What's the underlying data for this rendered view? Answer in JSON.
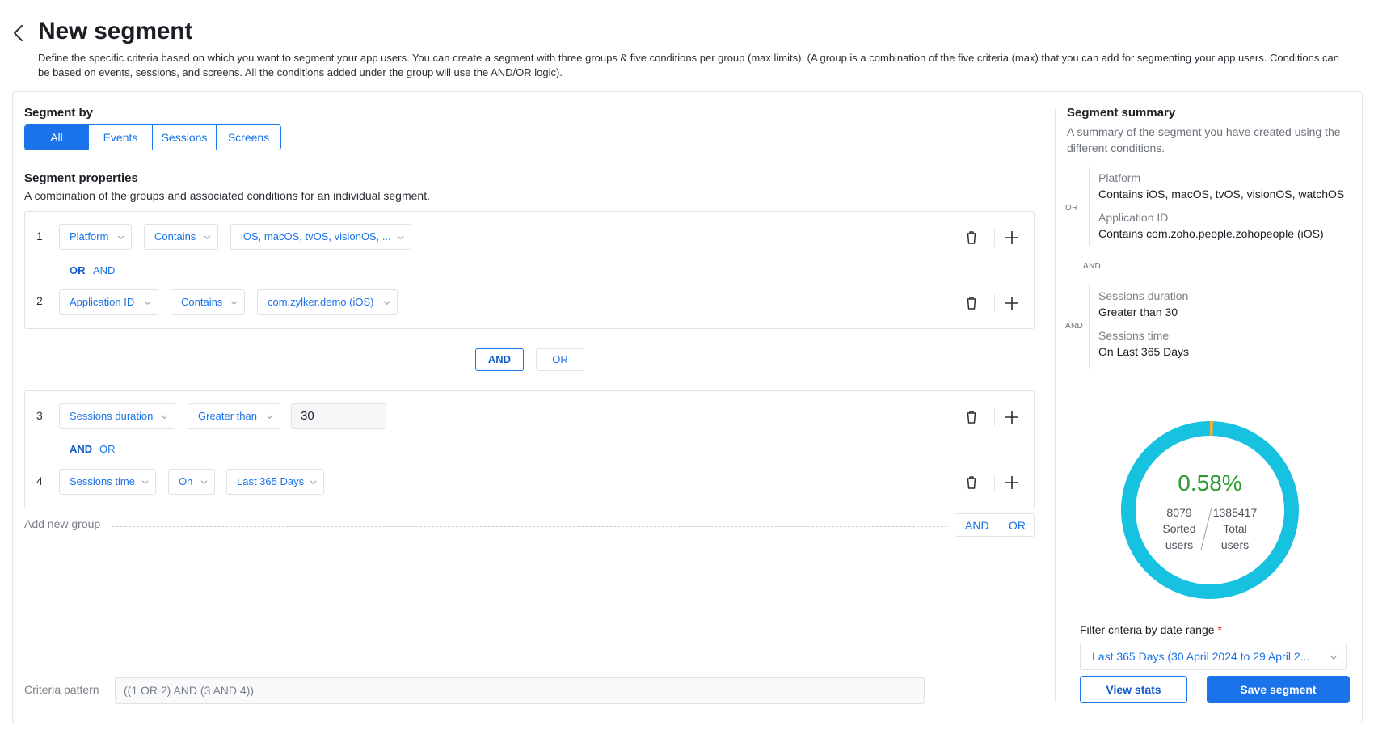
{
  "header": {
    "title": "New segment",
    "description": "Define the specific criteria based on which you want to segment your app users. You can create a segment with three groups & five conditions per group (max limits). (A group is a combination of the five criteria (max) that you can add for segmenting your app users. Conditions can be based on events, sessions, and screens. All the conditions added under the group will use the AND/OR logic)."
  },
  "segment_by": {
    "label": "Segment by",
    "tabs": [
      {
        "label": "All",
        "active": true
      },
      {
        "label": "Events",
        "active": false
      },
      {
        "label": "Sessions",
        "active": false
      },
      {
        "label": "Screens",
        "active": false
      }
    ]
  },
  "properties": {
    "label": "Segment properties",
    "subtitle": "A combination of the groups and associated conditions for an individual segment."
  },
  "groups": [
    {
      "conditions": [
        {
          "num": "1",
          "property": "Platform",
          "operator": "Contains",
          "value": "iOS, macOS, tvOS, visionOS, ..."
        },
        {
          "num": "2",
          "property": "Application ID",
          "operator": "Contains",
          "value": "com.zylker.demo (iOS)"
        }
      ],
      "logic_selected": "OR",
      "logic_other": "AND"
    },
    {
      "conditions": [
        {
          "num": "3",
          "property": "Sessions duration",
          "operator": "Greater than",
          "value": "30"
        },
        {
          "num": "4",
          "property": "Sessions time",
          "operator": "On",
          "value": "Last 365 Days"
        }
      ],
      "logic_selected": "AND",
      "logic_other": "OR"
    }
  ],
  "group_connector": {
    "selected": "AND",
    "other": "OR"
  },
  "add_group": {
    "label": "Add new group",
    "and_label": "AND",
    "or_label": "OR"
  },
  "criteria": {
    "label": "Criteria pattern",
    "value": "((1 OR 2) AND (3 AND 4))"
  },
  "summary": {
    "title": "Segment summary",
    "subtitle": "A summary of the segment you have created using the different conditions.",
    "group1_logic": "OR",
    "between_groups": "AND",
    "group2_logic": "AND",
    "items": [
      {
        "head": "Platform",
        "value": "Contains iOS, macOS, tvOS, visionOS, watchOS"
      },
      {
        "head": "Application ID",
        "value": "Contains com.zoho.people.zohopeople (iOS)"
      },
      {
        "head": "Sessions duration",
        "value": "Greater than 30"
      },
      {
        "head": "Sessions time",
        "value": "On Last 365 Days"
      }
    ]
  },
  "stats": {
    "percent": "0.58%",
    "percent_fraction": 0.0058,
    "sorted_count": "8079",
    "sorted_label_1": "Sorted",
    "sorted_label_2": "users",
    "total_count": "1385417",
    "total_label_1": "Total",
    "total_label_2": "users",
    "ring_color": "#17c1e0",
    "segment_color": "#f2b233"
  },
  "filter": {
    "label": "Filter criteria by date range",
    "required_mark": "*",
    "value": "Last 365 Days (30 April 2024 to 29 April 2..."
  },
  "buttons": {
    "view_stats": "View stats",
    "save": "Save segment"
  },
  "colors": {
    "accent": "#1a73e8",
    "success": "#2a9b2f"
  }
}
